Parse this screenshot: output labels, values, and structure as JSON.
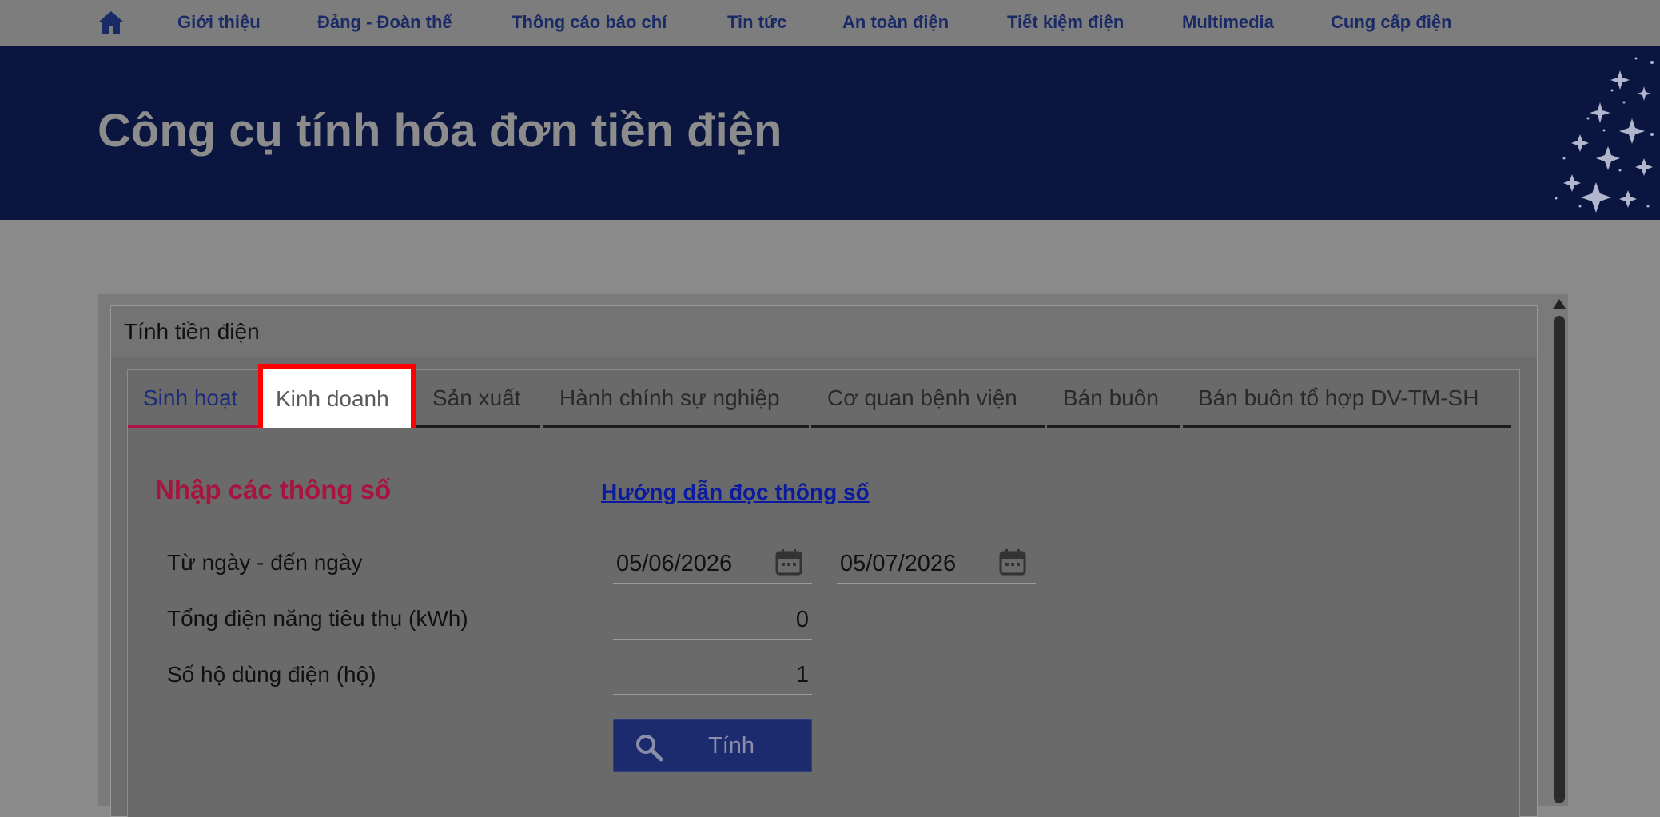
{
  "nav": {
    "home_icon": "home-icon",
    "items": [
      "Giới thiệu",
      "Đảng - Đoàn thể",
      "Thông cáo báo chí",
      "Tin tức",
      "An toàn điện",
      "Tiết kiệm điện",
      "Multimedia",
      "Cung cấp điện"
    ]
  },
  "banner": {
    "title": "Công cụ tính hóa đơn tiền điện"
  },
  "panel": {
    "title": "Tính tiền điện"
  },
  "tabs": [
    "Sinh hoạt",
    "Kinh doanh",
    "Sản xuất",
    "Hành chính sự nghiệp",
    "Cơ quan bệnh viện",
    "Bán buôn",
    "Bán buôn tổ hợp DV-TM-SH"
  ],
  "form": {
    "section_title": "Nhập các thông số",
    "guide_link": "Hướng dẫn đọc thông số",
    "date_label": "Từ ngày - đến ngày",
    "from_date": "05/06/2026",
    "to_date": "05/07/2026",
    "consumption_label": "Tổng điện năng tiêu thụ (kWh)",
    "consumption_value": "0",
    "households_label": "Số hộ dùng điện (hộ)",
    "households_value": "1",
    "calculate_button": "Tính"
  },
  "colors": {
    "banner_bg": "#0a1640",
    "nav_text": "#1a2a66",
    "section_title": "#a8143f",
    "link": "#0b1ba0",
    "button_bg": "#1c2b6e",
    "highlight_border": "#ff0000"
  }
}
